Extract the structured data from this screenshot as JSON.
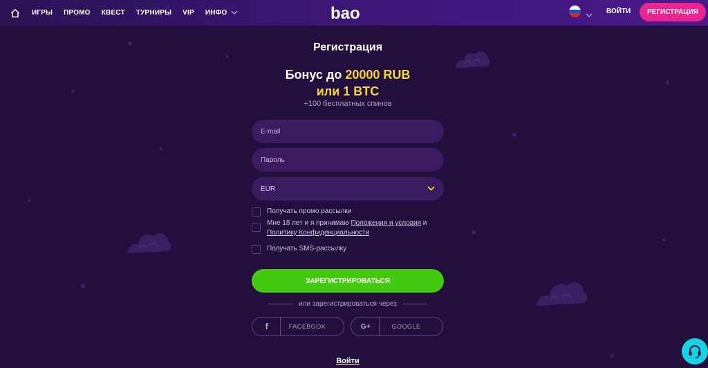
{
  "header": {
    "nav": [
      "ИГРЫ",
      "ПРОМО",
      "КВЕСТ",
      "ТУРНИРЫ",
      "VIP",
      "ИНФО"
    ],
    "logo": "bao",
    "login": "ВОЙТИ",
    "register": "РЕГИСТРАЦИЯ"
  },
  "form": {
    "title": "Регистрация",
    "bonus_prefix": "Бонус до ",
    "bonus_amount": "20000 RUB",
    "bonus_line2": "или 1 BTC",
    "spins": "+100 бесплатных спинов",
    "email_placeholder": "E-mail",
    "password_placeholder": "Пароль",
    "currency": "EUR",
    "checkbox_promo": "Получать промо рассылки",
    "checkbox_age_prefix": "Мне 18 лет и я принимаю ",
    "terms_link": "Положения и условия",
    "and": " и",
    "privacy_link": "Политику Конфиденциальности",
    "checkbox_sms": "Получать SMS-рассылку",
    "submit": "ЗАРЕГИСТРИРОВАТЬСЯ",
    "or_register_via": "или зарегистрироваться через",
    "facebook": "FACEBOOK",
    "google": "GOOGLE",
    "login_link": "Войти"
  },
  "icons": {
    "home": "home-icon",
    "flag": "russia-flag-icon",
    "support": "headset-icon"
  },
  "colors": {
    "background": "#230f3d",
    "accent_pink": "#ea2490",
    "accent_green": "#44c911",
    "accent_yellow": "#f6d63b",
    "support": "#1ad1e3"
  }
}
